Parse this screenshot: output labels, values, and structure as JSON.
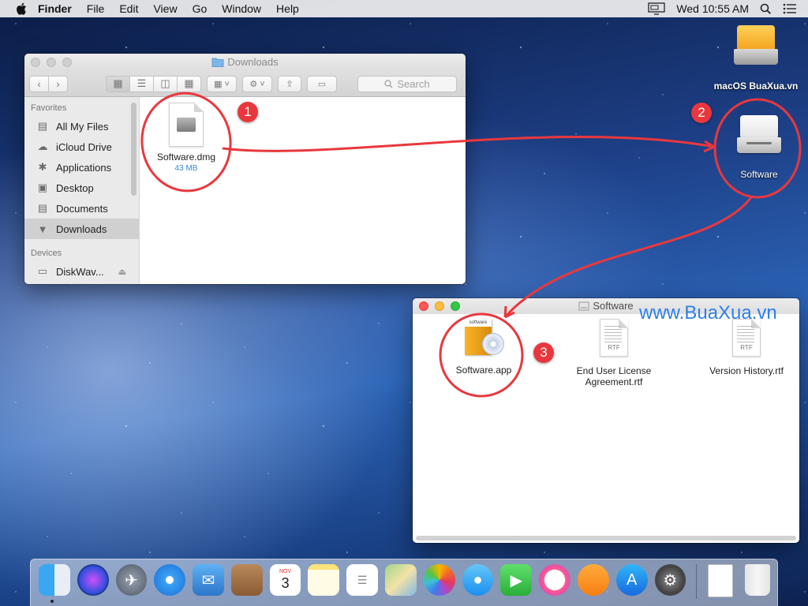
{
  "menubar": {
    "items": [
      "Finder",
      "File",
      "Edit",
      "View",
      "Go",
      "Window",
      "Help"
    ],
    "clock": "Wed 10:55 AM"
  },
  "desktop": {
    "icons": [
      {
        "label": "macOS BuaXua.vn",
        "icon": "hard-drive-icon"
      },
      {
        "label": "Software",
        "icon": "mounted-disk-icon"
      }
    ]
  },
  "downloads_window": {
    "title": "Downloads",
    "search_placeholder": "Search",
    "sidebar": {
      "favorites_header": "Favorites",
      "favorites": [
        {
          "label": "All My Files",
          "icon": "all-files-icon"
        },
        {
          "label": "iCloud Drive",
          "icon": "cloud-icon"
        },
        {
          "label": "Applications",
          "icon": "applications-icon"
        },
        {
          "label": "Desktop",
          "icon": "desktop-icon"
        },
        {
          "label": "Documents",
          "icon": "documents-icon"
        },
        {
          "label": "Downloads",
          "icon": "downloads-icon",
          "selected": true
        }
      ],
      "devices_header": "Devices",
      "devices": [
        {
          "label": "DiskWav...",
          "icon": "disk-icon"
        }
      ]
    },
    "files": [
      {
        "name": "Software.dmg",
        "size": "43 MB",
        "icon": "dmg-icon"
      }
    ]
  },
  "software_window": {
    "title": "Software",
    "files": [
      {
        "name": "Software.app",
        "icon": "app-box-icon"
      },
      {
        "name_line1": "End User License",
        "name_line2": "Agreement.rtf",
        "icon": "rtf-icon",
        "tag": "RTF"
      },
      {
        "name": "Version History.rtf",
        "icon": "rtf-icon",
        "tag": "RTF"
      }
    ]
  },
  "annotations": [
    "1",
    "2",
    "3"
  ],
  "watermark": "www.BuaXua.vn",
  "dock": {
    "apps": [
      "finder",
      "siri",
      "launchpad",
      "safari",
      "mail",
      "contacts",
      "calendar",
      "notes",
      "reminders",
      "maps",
      "photos",
      "messages",
      "facetime",
      "itunes",
      "ibooks",
      "app-store",
      "system-preferences"
    ],
    "calendar_month": "NOV",
    "calendar_day": "3"
  },
  "colors": {
    "annotation_red": "#e8383d",
    "selection_gray": "#d0d0d0",
    "watermark_blue": "#2f7fe6"
  }
}
